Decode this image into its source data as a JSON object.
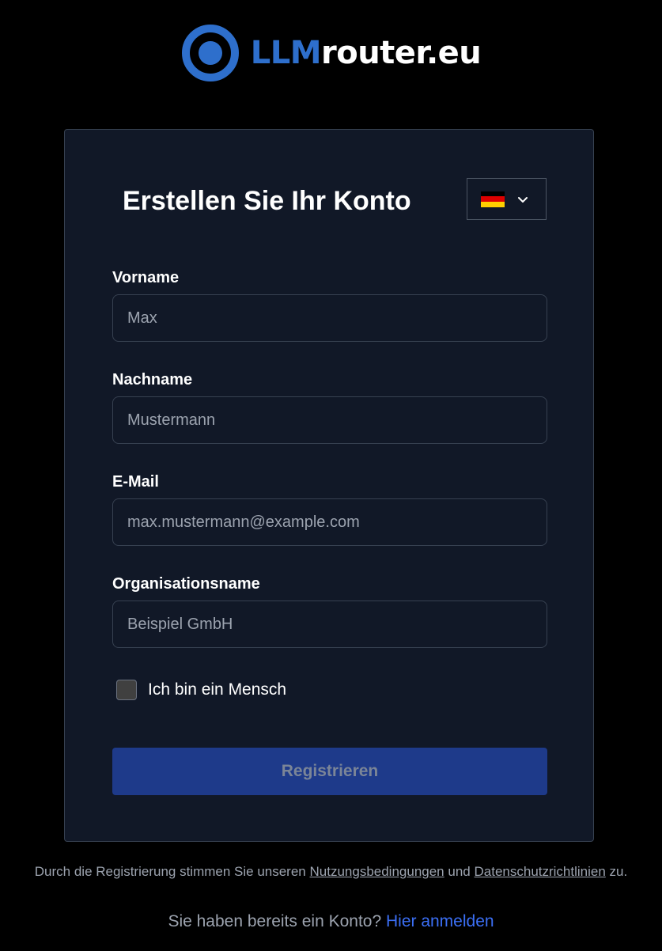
{
  "brand": {
    "name_accent": "LLM",
    "name_rest": "router.eu",
    "accent_color": "#2e6fcc"
  },
  "form": {
    "title": "Erstellen Sie Ihr Konto",
    "language": {
      "selected": "de",
      "icon": "germany-flag-icon",
      "dropdown_icon": "chevron-down-icon"
    },
    "fields": {
      "first_name": {
        "label": "Vorname",
        "placeholder": "Max",
        "value": ""
      },
      "last_name": {
        "label": "Nachname",
        "placeholder": "Mustermann",
        "value": ""
      },
      "email": {
        "label": "E-Mail",
        "placeholder": "max.mustermann@example.com",
        "value": ""
      },
      "organization": {
        "label": "Organisationsname",
        "placeholder": "Beispiel GmbH",
        "value": ""
      }
    },
    "captcha": {
      "label": "Ich bin ein Mensch",
      "checked": false
    },
    "submit": {
      "label": "Registrieren",
      "color": "#1e3a8a",
      "disabled": true
    }
  },
  "footer": {
    "terms_prefix": "Durch die Registrierung stimmen Sie unseren",
    "terms_link": "Nutzungsbedingungen",
    "terms_and": "und",
    "privacy_link": "Datenschutzrichtlinien",
    "terms_suffix": "zu.",
    "login_prompt": "Sie haben bereits ein Konto?",
    "login_link": "Hier anmelden",
    "link_color": "#3b6ff5"
  }
}
